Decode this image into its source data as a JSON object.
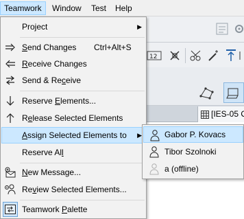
{
  "menubar": {
    "items": [
      {
        "label": "Teamwork",
        "active": true
      },
      {
        "label": "Window"
      },
      {
        "label": "Test"
      },
      {
        "label": "Help"
      }
    ]
  },
  "background": {
    "tab_label": "[IES-05 O"
  },
  "menu": {
    "project": "Project",
    "send_changes": "Send Changes",
    "send_changes_shortcut": "Ctrl+Alt+S",
    "receive_changes": "Receive Changes",
    "send_receive": "Send & Receive",
    "reserve_elements": "Reserve Elements...",
    "release_selected": "Release Selected Elements",
    "assign_selected": "Assign Selected Elements to",
    "reserve_all": "Reserve All",
    "new_message": "New Message...",
    "review_selected": "Review Selected Elements...",
    "teamwork_palette": "Teamwork Palette"
  },
  "submenu": {
    "users": [
      {
        "label": "Gabor P. Kovacs",
        "highlighted": true
      },
      {
        "label": "Tibor Szolnoki"
      },
      {
        "label": "a (offline)",
        "offline": true
      }
    ]
  },
  "colors": {
    "highlight": "#cce8ff",
    "highlight_border": "#99d1ff",
    "menu_bg": "#f2f2f2"
  }
}
